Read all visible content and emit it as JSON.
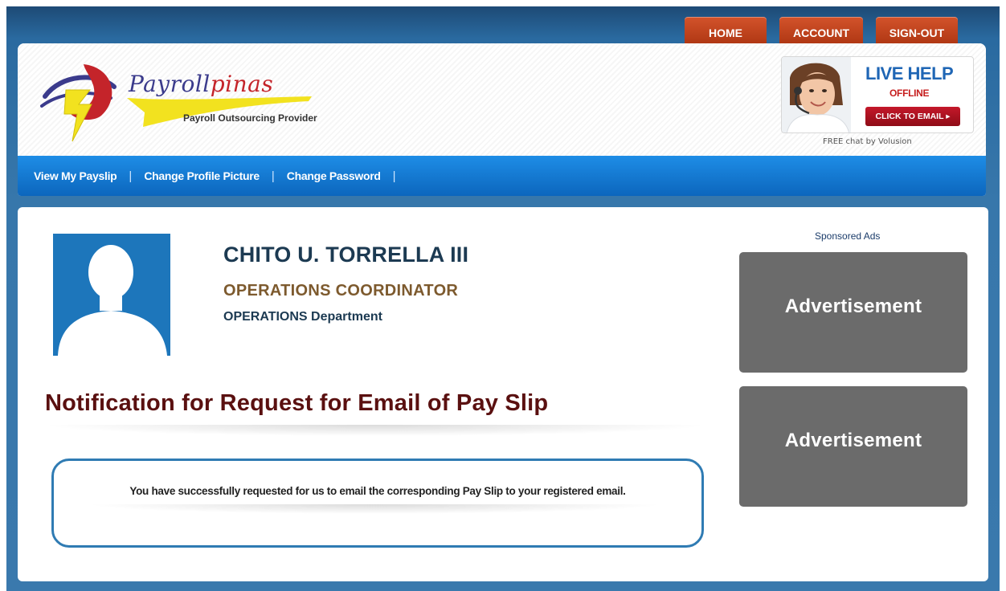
{
  "topnav": {
    "home": "HOME",
    "account": "ACCOUNT",
    "signout": "SIGN-OUT"
  },
  "brand": {
    "name_part1": "Payroll",
    "name_part2": "pinas",
    "tagline": "Payroll Outsourcing Provider",
    "colors": {
      "blue": "#3b3b8c",
      "red": "#c4242a",
      "yellow": "#f2e21f"
    }
  },
  "live_help": {
    "title": "LIVE HELP",
    "status": "OFFLINE",
    "button": "CLICK TO EMAIL ▸",
    "caption": "FREE chat by Volusion"
  },
  "subnav": {
    "items": [
      {
        "label": "View My Payslip"
      },
      {
        "label": "Change Profile Picture"
      },
      {
        "label": "Change Password"
      }
    ],
    "separator": "|"
  },
  "employee": {
    "name": "CHITO U. TORRELLA III",
    "position": "OPERATIONS COORDINATOR",
    "department": "OPERATIONS Department"
  },
  "notification": {
    "title": "Notification for Request for Email of Pay Slip",
    "message": "You have successfully requested for us to email the corresponding Pay Slip to your registered email."
  },
  "sidebar": {
    "sponsored_label": "Sponsored Ads",
    "ads": [
      "Advertisement",
      "Advertisement"
    ]
  },
  "colors": {
    "frame": "#3777ab",
    "nav_tab": "#c44320",
    "subnav": "#1474cf",
    "notif_title": "#5a1010",
    "ad_bg": "#6b6b6b"
  }
}
